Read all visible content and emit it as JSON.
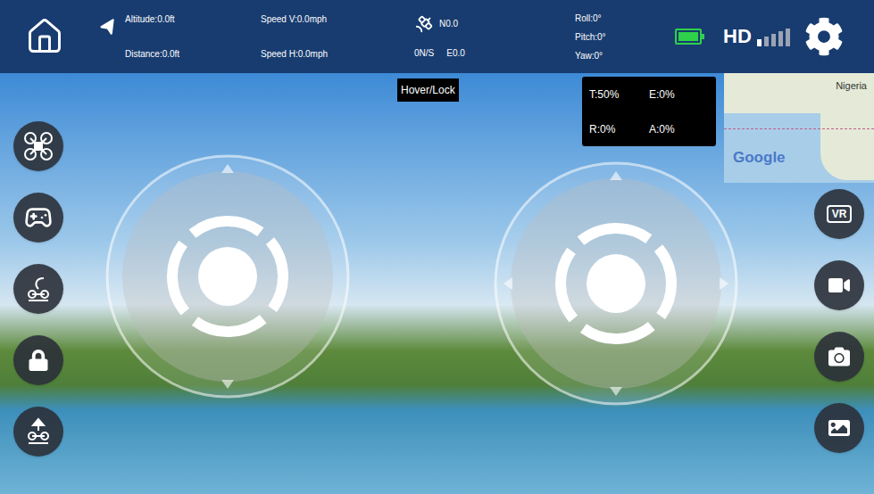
{
  "top_bar": {
    "altitude": "Altitude:0.0ft",
    "distance": "Distance:0.0ft",
    "speed_v": "Speed V:0.0mph",
    "speed_h": "Speed H:0.0mph",
    "gps": {
      "north": "N0.0",
      "ns": "0N/S",
      "east": "E0.0"
    },
    "attitude": [
      "Roll:0°",
      "Pitch:0°",
      "Yaw:0°"
    ],
    "battery": {
      "level": 1
    },
    "signal": {
      "label": "HD",
      "level": 0.2
    }
  },
  "mode_label": "Hover/Lock",
  "channels": [
    {
      "text": "T:50%"
    },
    {
      "text": "E:0%"
    },
    {
      "text": "R:0%"
    },
    {
      "text": "A:0%"
    }
  ],
  "map": {
    "country": "Nigeria",
    "logo": "Google"
  },
  "vr_label": "VR"
}
